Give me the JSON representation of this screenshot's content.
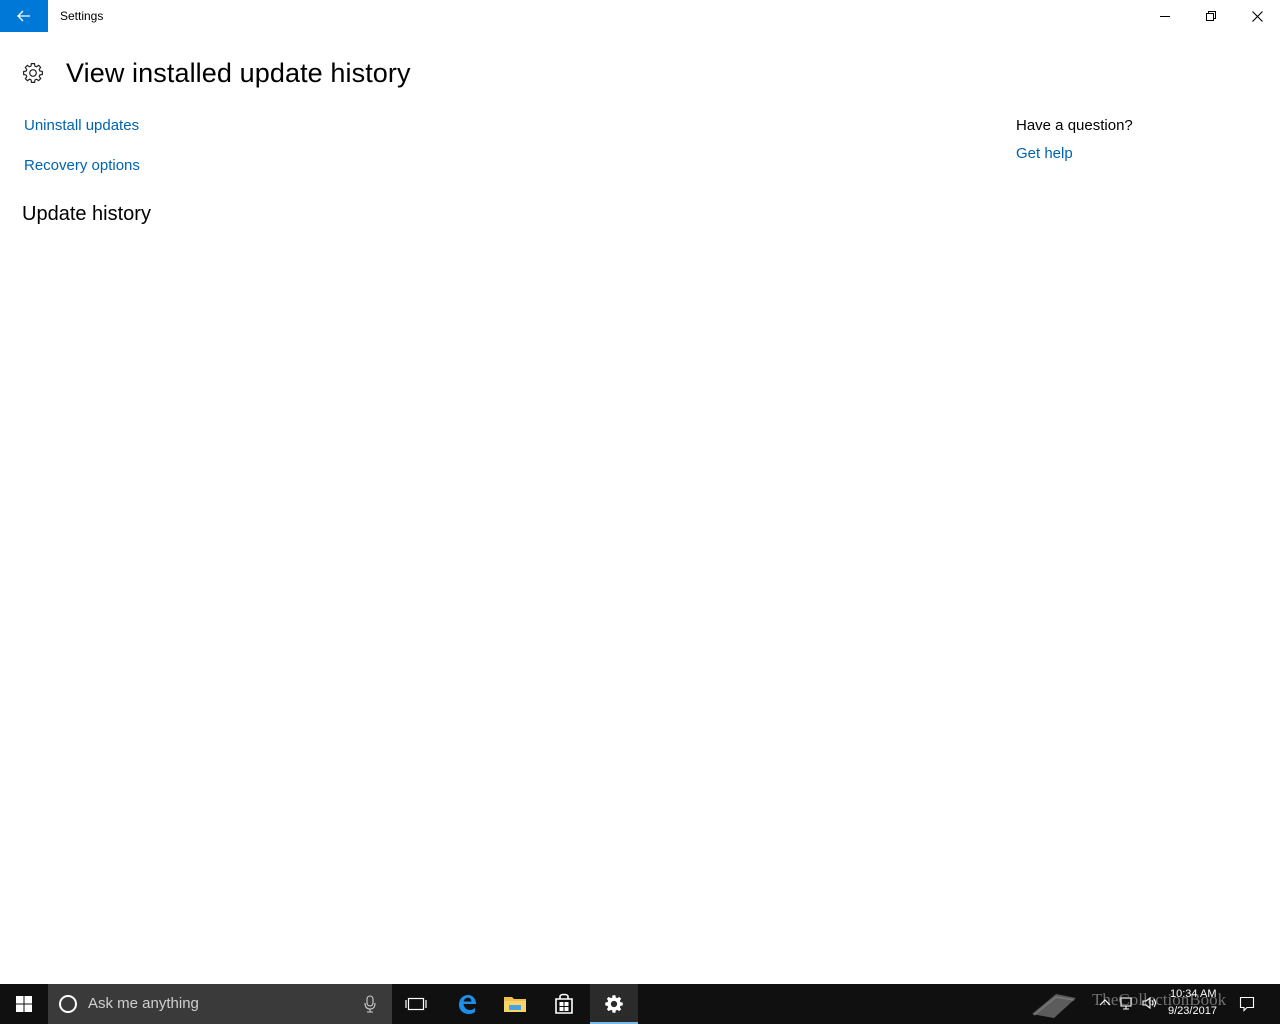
{
  "window": {
    "title": "Settings"
  },
  "header": {
    "title": "View installed update history"
  },
  "links": {
    "uninstall": "Uninstall updates",
    "recovery": "Recovery options"
  },
  "section": {
    "heading": "Update history"
  },
  "help": {
    "question": "Have a question?",
    "link": "Get help"
  },
  "taskbar": {
    "search_placeholder": "Ask me anything",
    "apps": [
      "task-view-icon",
      "edge-icon",
      "file-explorer-icon",
      "store-icon",
      "settings-icon"
    ],
    "active_app": "settings"
  },
  "tray": {
    "time": "10:34 AM",
    "date": "9/23/2017"
  },
  "watermark": {
    "text": "TheCollectionBook"
  },
  "colors": {
    "accent": "#0078d7",
    "link": "#0063b1",
    "taskbar": "#101010"
  }
}
